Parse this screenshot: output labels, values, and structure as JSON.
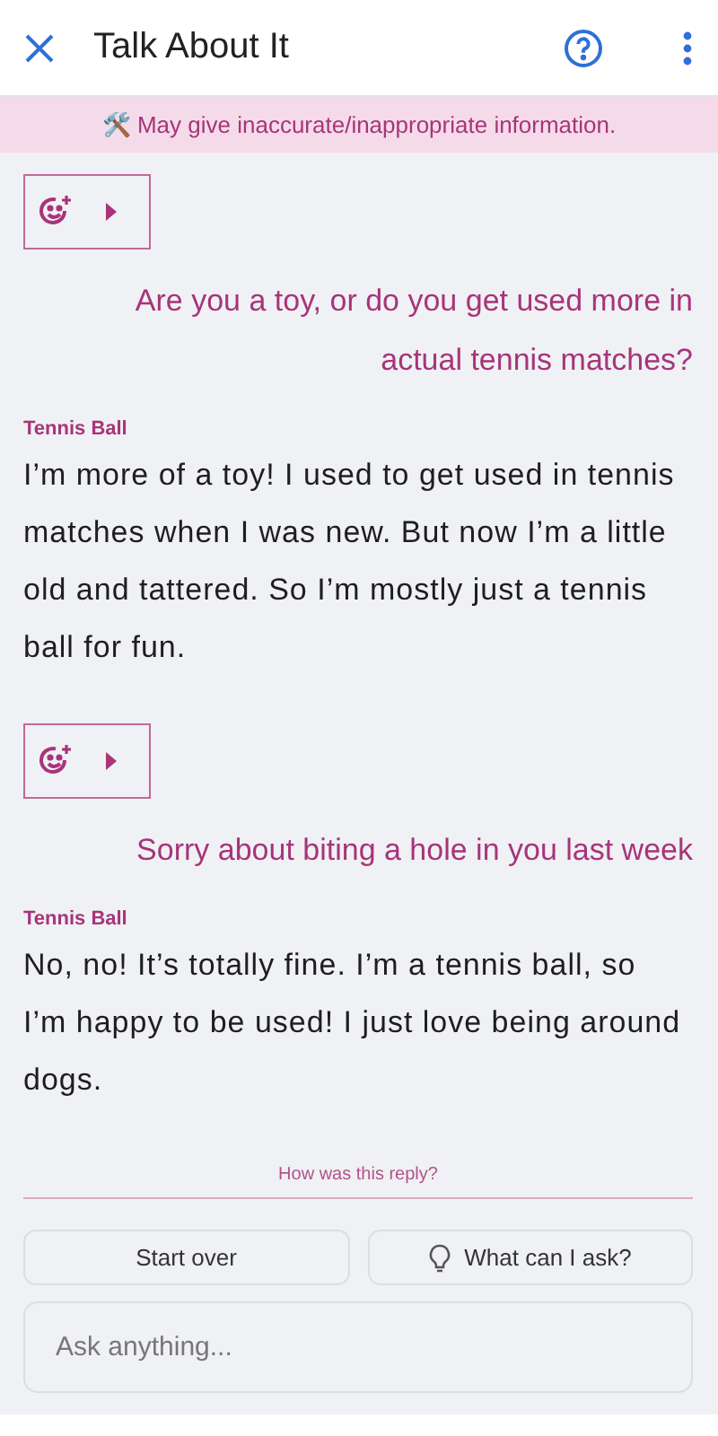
{
  "header": {
    "title": "Talk About It"
  },
  "banner": {
    "text": "🛠️ May give inaccurate/inappropriate information."
  },
  "messages": [
    {
      "kind": "reactions"
    },
    {
      "kind": "user",
      "text": "Are you a toy, or do you get used more in actual tennis matches?"
    },
    {
      "kind": "bot",
      "sender": "Tennis Ball",
      "text": "I’m more of a toy! I used to get used in tennis matches when I was new. But now I’m a little old and tattered. So I’m mostly just a tennis ball for fun."
    },
    {
      "kind": "reactions"
    },
    {
      "kind": "user",
      "text": "Sorry about biting a hole in you last week"
    },
    {
      "kind": "bot",
      "sender": "Tennis Ball",
      "text": "No, no! It’s totally fine. I’m a tennis ball, so I’m happy to be used! I just love being around dogs."
    }
  ],
  "feedback": {
    "text": "How was this reply?"
  },
  "actions": [
    {
      "kind": "plain",
      "label": "Start over"
    },
    {
      "kind": "hint",
      "label": "What can I ask?"
    }
  ],
  "input": {
    "placeholder": "Ask anything..."
  }
}
